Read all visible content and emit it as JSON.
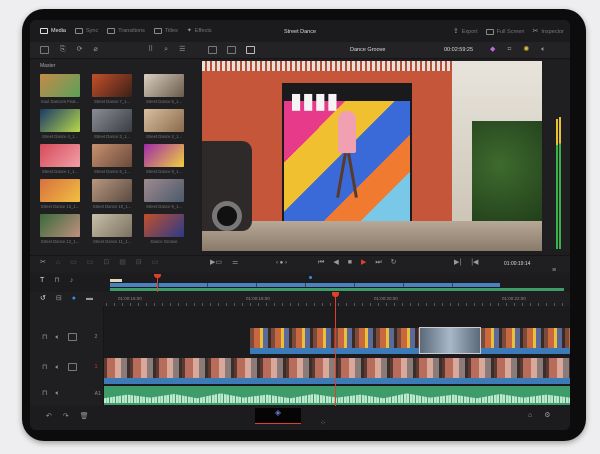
{
  "header": {
    "tabs": [
      {
        "label": "Media",
        "icon": "media-icon",
        "active": true
      },
      {
        "label": "Sync",
        "icon": "sync-icon"
      },
      {
        "label": "Transitions",
        "icon": "transitions-icon"
      },
      {
        "label": "Titles",
        "icon": "titles-icon"
      },
      {
        "label": "Effects",
        "icon": "effects-icon"
      }
    ],
    "project_title": "Street Dance",
    "right": [
      {
        "label": "Export",
        "icon": "export-icon"
      },
      {
        "label": "Full Screen",
        "icon": "fullscreen-icon"
      },
      {
        "label": "Inspector",
        "icon": "inspector-icon"
      }
    ]
  },
  "viewer": {
    "clip_name": "Dance Groove",
    "duration": "00:02:59:25",
    "timecode": "01:00:19:14"
  },
  "media_pool": {
    "bin": "Master",
    "clips": [
      {
        "name": "Soul Dancers Feat...",
        "c1": "#c58a4a",
        "c2": "#5aa15a"
      },
      {
        "name": "Street Dance 7_1...",
        "c1": "#c4502a",
        "c2": "#3a2018"
      },
      {
        "name": "Street Dance 5_1...",
        "c1": "#d8d0c0",
        "c2": "#6a5a4a"
      },
      {
        "name": "Street Dance 4_1...",
        "c1": "#1a3a6a",
        "c2": "#b8d84a"
      },
      {
        "name": "Street Dance 3_1...",
        "c1": "#8a8e94",
        "c2": "#3a3e44"
      },
      {
        "name": "Street Dance 2_1...",
        "c1": "#d8c0a0",
        "c2": "#8a6a4a"
      },
      {
        "name": "Street Dance 1_1...",
        "c1": "#d84a5a",
        "c2": "#f0a0a8"
      },
      {
        "name": "Street Dance 6_1...",
        "c1": "#c89070",
        "c2": "#6a4a3a"
      },
      {
        "name": "Street Dance 8_1...",
        "c1": "#a02aa8",
        "c2": "#f0d040"
      },
      {
        "name": "Street Dance 13_1...",
        "c1": "#d87040",
        "c2": "#f0c040"
      },
      {
        "name": "Street Dance 10_1...",
        "c1": "#b89880",
        "c2": "#5a4a40"
      },
      {
        "name": "Street Dance 9_1...",
        "c1": "#a08a90",
        "c2": "#4a5a6a"
      },
      {
        "name": "Street Dance 12_1...",
        "c1": "#3a6a3a",
        "c2": "#c09080"
      },
      {
        "name": "Street Dance 11_1...",
        "c1": "#c8c0a8",
        "c2": "#7a7060"
      },
      {
        "name": "Dance Groove",
        "c1": "#c4502a",
        "c2": "#2a3a8a"
      }
    ]
  },
  "timeline": {
    "ruler": [
      "01:00:16:00",
      "01:00:18:00",
      "01:00:20:00",
      "01:00:22:00"
    ],
    "tracks": [
      {
        "label": "2"
      },
      {
        "label": "1"
      },
      {
        "label": "A1"
      }
    ]
  },
  "colors": {
    "playhead": "#e0402a",
    "video_clip": "#3d7ab8",
    "audio_clip": "#3e9c6a",
    "audio_wave": "#bfe8cf"
  }
}
